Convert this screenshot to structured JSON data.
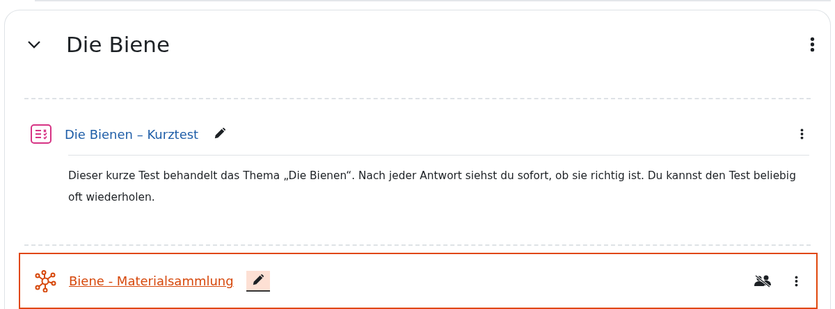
{
  "section": {
    "title": "Die Biene",
    "expanded": true
  },
  "activities": [
    {
      "kind": "quiz",
      "title": "Die Bienen – Kurztest",
      "highlighted": false,
      "group_mode": false,
      "description": "Dieser kurze Test behandelt das Thema „Die Bienen“. Nach jeder Antwort siehst du sofort, ob sie richtig ist. Du kannst den Test beliebig oft wiederholen."
    },
    {
      "kind": "network",
      "title": "Biene - Materialsammlung",
      "highlighted": true,
      "group_mode": true
    }
  ]
}
